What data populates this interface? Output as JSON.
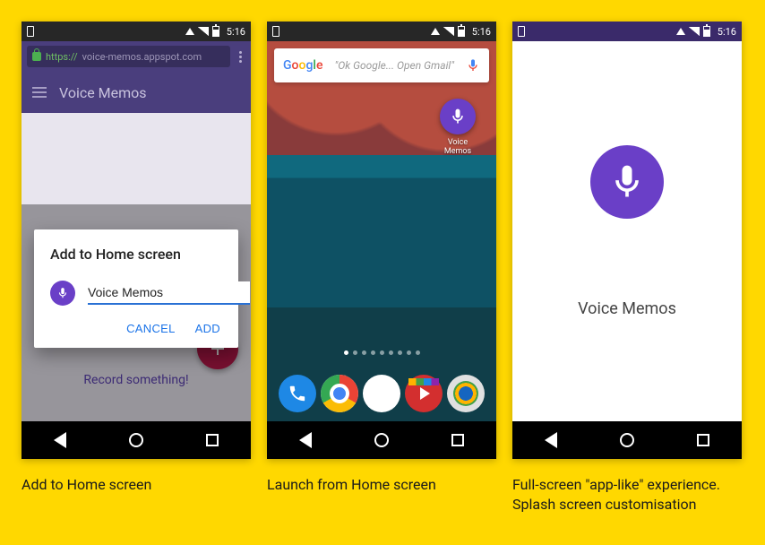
{
  "status": {
    "time": "5:16"
  },
  "phone1": {
    "url_proto": "https://",
    "url_host": "voice-memos.appspot.com",
    "header_title": "Voice Memos",
    "background_prompt": "Record something!",
    "dialog": {
      "title": "Add to Home screen",
      "input_value": "Voice Memos",
      "cancel": "CANCEL",
      "add": "ADD"
    }
  },
  "phone2": {
    "google_logo": "Google",
    "search_hint": "\"Ok Google... Open Gmail\"",
    "home_icon_label": "Voice Memos"
  },
  "phone3": {
    "splash_title": "Voice Memos"
  },
  "captions": {
    "c1": "Add to Home screen",
    "c2": "Launch from Home screen",
    "c3": "Full-screen \"app-like\" experience. Splash screen customisation"
  }
}
